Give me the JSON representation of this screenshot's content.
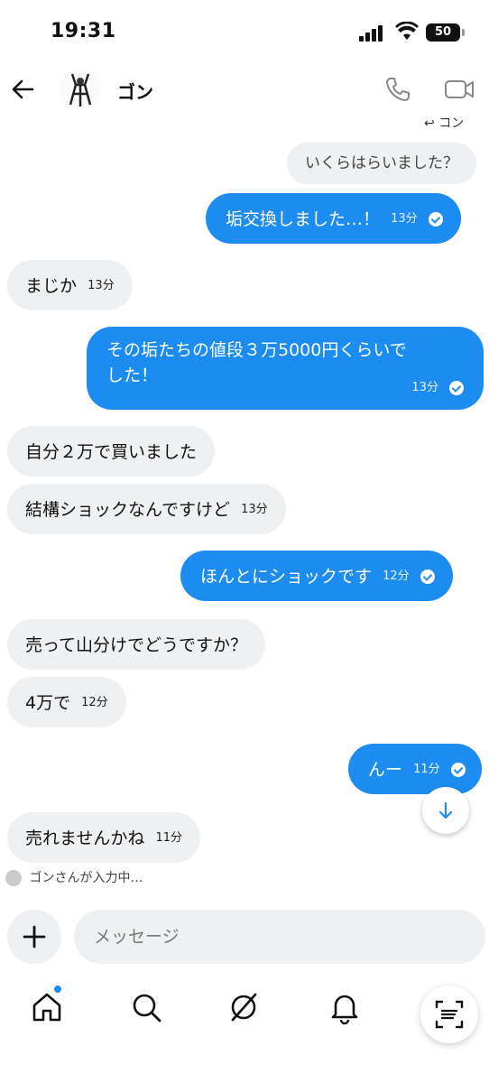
{
  "status_bar": {
    "time": "19:31",
    "battery": "50"
  },
  "header": {
    "contact_name": "ゴン"
  },
  "reply": {
    "label": "コン",
    "quoted_text": "いくらはらいました？"
  },
  "messages": [
    {
      "direction": "out",
      "text": "垢交換しました…！",
      "time": "13分",
      "read": true
    },
    {
      "direction": "in",
      "text": "まじか",
      "time": "13分"
    },
    {
      "direction": "out",
      "text_line1": "その垢たちの値段３万5000円くらいで",
      "text_line2": "した！",
      "time": "13分",
      "read": true
    },
    {
      "direction": "in",
      "text": "自分２万で買いました",
      "time": ""
    },
    {
      "direction": "in",
      "text": "結構ショックなんですけど",
      "time": "13分"
    },
    {
      "direction": "out",
      "text": "ほんとにショックです",
      "time": "12分",
      "read": true
    },
    {
      "direction": "in",
      "text": "売って山分けでどうですか？",
      "time": ""
    },
    {
      "direction": "in",
      "text": "4万で",
      "time": "12分"
    },
    {
      "direction": "out",
      "text": "んー",
      "time": "11分",
      "read": true
    },
    {
      "direction": "in",
      "text": "売れませんかね",
      "time": "11分"
    }
  ],
  "typing_indicator": "ゴンさんが入力中…",
  "composer": {
    "placeholder": "メッセージ"
  },
  "colors": {
    "accent": "#1d8cf0",
    "incoming_bubble": "#eef0f2"
  },
  "icons": [
    "back-arrow-icon",
    "phone-icon",
    "video-icon",
    "reply-icon",
    "chevron-down-icon",
    "plus-icon",
    "home-icon",
    "search-icon",
    "grok-icon",
    "bell-icon",
    "mail-icon",
    "scan-icon"
  ]
}
